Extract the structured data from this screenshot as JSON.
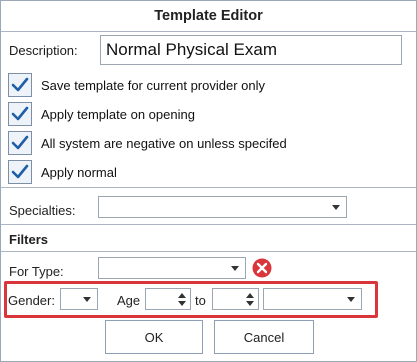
{
  "window": {
    "title": "Template Editor"
  },
  "description": {
    "label": "Description:",
    "value": "Normal Physical Exam"
  },
  "checkboxes": [
    {
      "label": "Save template for current provider only",
      "checked": true
    },
    {
      "label": "Apply template on opening",
      "checked": true
    },
    {
      "label": "All system are negative on unless specifed",
      "checked": true
    },
    {
      "label": "Apply normal",
      "checked": true
    }
  ],
  "specialties": {
    "label": "Specialties:",
    "value": ""
  },
  "filters": {
    "title": "Filters",
    "for_type": {
      "label": "For Type:",
      "value": ""
    },
    "gender": {
      "label": "Gender:",
      "value": ""
    },
    "age": {
      "label": "Age",
      "from": "",
      "to_label": "to",
      "to": "",
      "unit": ""
    }
  },
  "buttons": {
    "ok": "OK",
    "cancel": "Cancel"
  },
  "colors": {
    "accent": "#1e5fa8",
    "highlight": "#d9353a",
    "clear": "#d9353a"
  }
}
